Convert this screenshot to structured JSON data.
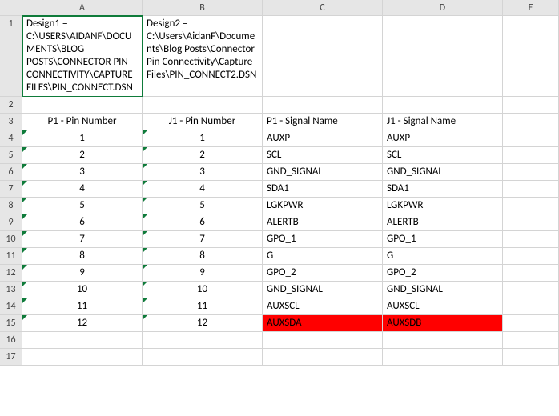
{
  "columns": [
    "A",
    "B",
    "C",
    "D",
    "E"
  ],
  "row1": {
    "A": "Design1 = C:\\USERS\\AIDANF\\DOCUMENTS\\BLOG POSTS\\CONNECTOR PIN CONNECTIVITY\\CAPTURE FILES\\PIN_CONNECT.DSN",
    "B": "Design2 = C:\\Users\\AidanF\\Documents\\Blog Posts\\Connector Pin Connectivity\\Capture Files\\PIN_CONNECT2.DSN"
  },
  "headers": {
    "A": "P1 - Pin Number",
    "B": "J1 - Pin Number",
    "C": "P1 - Signal Name",
    "D": "J1 - Signal Name"
  },
  "rows": [
    {
      "n": 4,
      "p": "1",
      "j": "1",
      "cs": "AUXP",
      "ds": "AUXP"
    },
    {
      "n": 5,
      "p": "2",
      "j": "2",
      "cs": "SCL",
      "ds": "SCL"
    },
    {
      "n": 6,
      "p": "3",
      "j": "3",
      "cs": "GND_SIGNAL",
      "ds": "GND_SIGNAL"
    },
    {
      "n": 7,
      "p": "4",
      "j": "4",
      "cs": "SDA1",
      "ds": "SDA1"
    },
    {
      "n": 8,
      "p": "5",
      "j": "5",
      "cs": "LGKPWR",
      "ds": "LGKPWR"
    },
    {
      "n": 9,
      "p": "6",
      "j": "6",
      "cs": "ALERTB",
      "ds": "ALERTB"
    },
    {
      "n": 10,
      "p": "7",
      "j": "7",
      "cs": "GPO_1",
      "ds": "GPO_1"
    },
    {
      "n": 11,
      "p": "8",
      "j": "8",
      "cs": "G",
      "ds": "G"
    },
    {
      "n": 12,
      "p": "9",
      "j": "9",
      "cs": "GPO_2",
      "ds": "GPO_2"
    },
    {
      "n": 13,
      "p": "10",
      "j": "10",
      "cs": "GND_SIGNAL",
      "ds": "GND_SIGNAL"
    },
    {
      "n": 14,
      "p": "11",
      "j": "11",
      "cs": "AUXSCL",
      "ds": "AUXSCL"
    },
    {
      "n": 15,
      "p": "12",
      "j": "12",
      "cs": "AUXSDA",
      "ds": "AUXSDB",
      "hl": true
    }
  ],
  "rownums": {
    "r1": "1",
    "r2": "2",
    "r3": "3",
    "r16": "16",
    "r17": "17"
  }
}
